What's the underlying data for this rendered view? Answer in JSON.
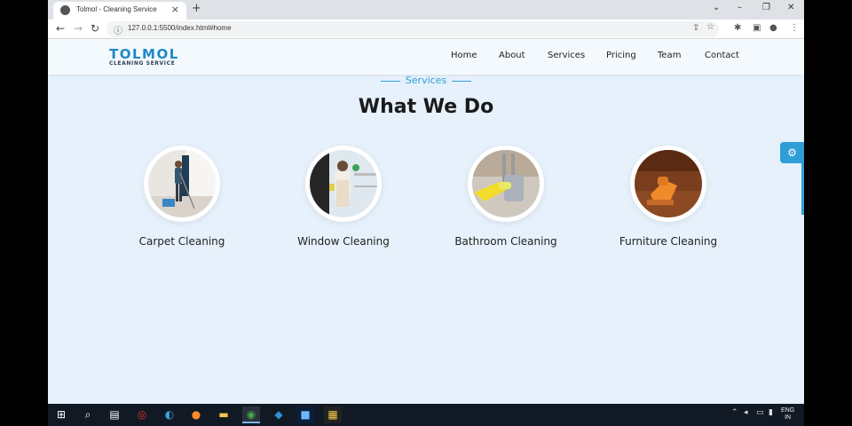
{
  "browser": {
    "tab_title": "Tolmol - Cleaning Service",
    "tab_close": "×",
    "new_tab": "+",
    "url": "127.0.0.1:5500/index.html#home",
    "controls": {
      "chevron": "⌄",
      "minimize": "–",
      "restore": "❐",
      "close": "✕"
    }
  },
  "site": {
    "logo": {
      "main": "TOLMOL",
      "sub": "CLEANING SERVICE"
    },
    "nav": [
      {
        "label": "Home"
      },
      {
        "label": "About"
      },
      {
        "label": "Services"
      },
      {
        "label": "Pricing"
      },
      {
        "label": "Team"
      },
      {
        "label": "Contact"
      }
    ],
    "section_tag": "Services",
    "section_title": "What We Do",
    "services": [
      {
        "name": "Carpet Cleaning"
      },
      {
        "name": "Window Cleaning"
      },
      {
        "name": "Bathroom Cleaning"
      },
      {
        "name": "Furniture Cleaning"
      }
    ],
    "accent_color": "#2f9ed6"
  },
  "taskbar": {
    "language": "ENG",
    "region": "IN",
    "apps": [
      "start-icon",
      "search-icon",
      "task-view-icon",
      "opera-icon",
      "edge-icon",
      "firefox-icon",
      "file-explorer-icon",
      "chrome-icon",
      "vscode-icon",
      "photoshop-icon",
      "app-icon"
    ]
  }
}
